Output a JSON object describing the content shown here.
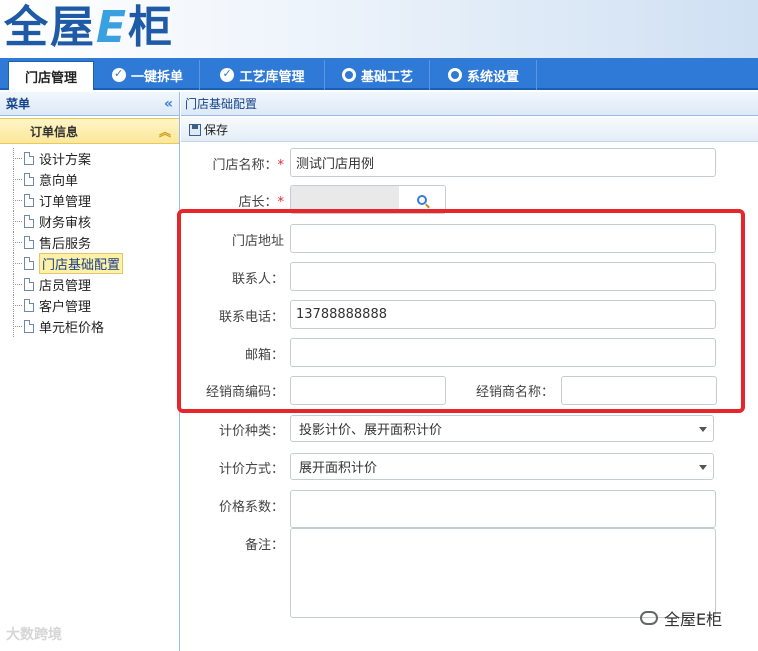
{
  "app": {
    "logo_text_1": "全屋",
    "logo_text_e": "E",
    "logo_text_2": "柜"
  },
  "nav": {
    "tabs": [
      {
        "label": "门店管理",
        "active": true
      },
      {
        "label": "一键拆单"
      },
      {
        "label": "工艺库管理"
      },
      {
        "label": "基础工艺"
      },
      {
        "label": "系统设置"
      }
    ]
  },
  "sidebar": {
    "title": "菜单",
    "group": "订单信息",
    "items": [
      {
        "label": "设计方案"
      },
      {
        "label": "意向单"
      },
      {
        "label": "订单管理"
      },
      {
        "label": "财务审核"
      },
      {
        "label": "售后服务"
      },
      {
        "label": "门店基础配置",
        "selected": true
      },
      {
        "label": "店员管理"
      },
      {
        "label": "客户管理"
      },
      {
        "label": "单元柜价格"
      }
    ]
  },
  "main": {
    "breadcrumb": "门店基础配置",
    "save_label": "保存"
  },
  "form": {
    "store_name_label": "门店名称：",
    "store_name_value": "测试门店用例",
    "manager_label": "店长：",
    "manager_value": "",
    "address_label": "门店地址",
    "address_value": "",
    "contact_label": "联系人：",
    "contact_value": "",
    "phone_label": "联系电话：",
    "phone_value": "13788888888",
    "email_label": "邮箱：",
    "email_value": "",
    "dealer_code_label": "经销商编码：",
    "dealer_code_value": "",
    "dealer_name_label": "经销商名称：",
    "dealer_name_value": "",
    "pricing_type_label": "计价种类：",
    "pricing_type_value": "投影计价、展开面积计价",
    "pricing_method_label": "计价方式：",
    "pricing_method_value": "展开面积计价",
    "price_factor_label": "价格系数：",
    "price_factor_value": "",
    "remark_label": "备注：",
    "remark_value": "",
    "required_mark": "*"
  },
  "watermarks": {
    "left": "大数跨境",
    "right": "全屋E柜"
  },
  "colors": {
    "nav_bg": "#2f7ad6",
    "highlight_box": "#e8252a",
    "selected_bg": "#fdf1a6"
  }
}
